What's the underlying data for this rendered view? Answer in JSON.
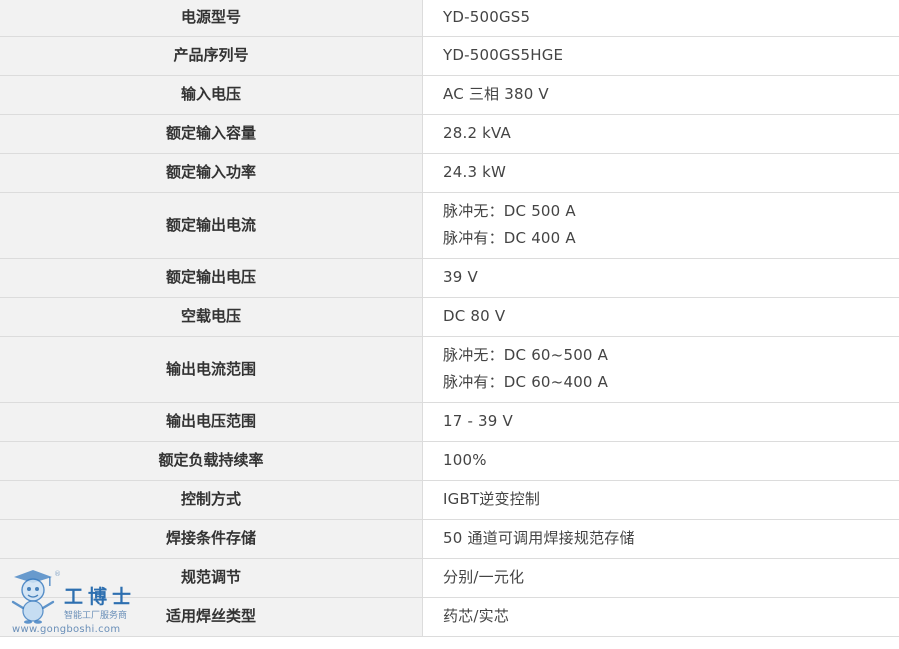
{
  "spec_rows": [
    {
      "label": "电源型号",
      "values": [
        "YD-500GS5"
      ]
    },
    {
      "label": "产品序列号",
      "values": [
        "YD-500GS5HGE"
      ]
    },
    {
      "label": "输入电压",
      "values": [
        "AC 三相 380 V"
      ]
    },
    {
      "label": "额定输入容量",
      "values": [
        "28.2 kVA"
      ]
    },
    {
      "label": "额定输入功率",
      "values": [
        "24.3 kW"
      ]
    },
    {
      "label": "额定输出电流",
      "values": [
        "脉冲无：DC 500 A",
        "脉冲有：DC 400 A"
      ]
    },
    {
      "label": "额定输出电压",
      "values": [
        "39 V"
      ]
    },
    {
      "label": "空载电压",
      "values": [
        "DC 80 V"
      ]
    },
    {
      "label": "输出电流范围",
      "values": [
        "脉冲无：DC 60~500 A",
        "脉冲有：DC 60~400 A"
      ]
    },
    {
      "label": "输出电压范围",
      "values": [
        "17 - 39 V"
      ]
    },
    {
      "label": "额定负载持续率",
      "values": [
        "100%"
      ]
    },
    {
      "label": "控制方式",
      "values": [
        "IGBT逆变控制"
      ]
    },
    {
      "label": "焊接条件存储",
      "values": [
        "50 通道可调用焊接规范存储"
      ]
    },
    {
      "label": "规范调节",
      "values": [
        "分别/一元化"
      ]
    },
    {
      "label": "适用焊丝类型",
      "values": [
        "药芯/实芯"
      ]
    }
  ],
  "watermark": {
    "brand": "工博士",
    "slogan": "智能工厂服务商",
    "url": "www.gongboshi.com",
    "registered_mark": "®"
  },
  "colors": {
    "label_bg": "#f2f2f2",
    "border": "#dcdcdc",
    "text": "#333333",
    "watermark_blue": "#2d6fb0"
  }
}
